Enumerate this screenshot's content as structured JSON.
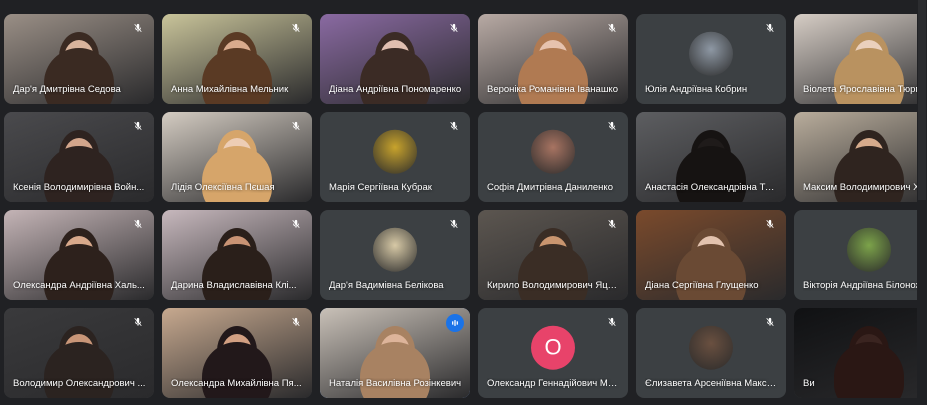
{
  "participants": [
    {
      "name": "Дар'я Дмитрівна Седова",
      "type": "video",
      "bg": "#9a8f86",
      "skin": "#d9b49c",
      "hair": "#3a2a22",
      "muted": true
    },
    {
      "name": "Анна Михайлівна Мельник",
      "type": "video",
      "bg": "#c9c49a",
      "skin": "#d9ab8d",
      "hair": "#5a3a24",
      "muted": true
    },
    {
      "name": "Діана Андріївна Пономаренко",
      "type": "video",
      "bg": "#8a6aa2",
      "skin": "#e1bfb0",
      "hair": "#3b2b25",
      "muted": true
    },
    {
      "name": "Вероніка Романівна Іванашко",
      "type": "video",
      "bg": "#b8aaa4",
      "skin": "#e6c2ae",
      "hair": "#b07a52",
      "muted": true
    },
    {
      "name": "Юлія Андріївна Кобрин",
      "type": "avatar",
      "avatar_color": "#8e98a4",
      "muted": true
    },
    {
      "name": "Віолета Ярославівна Тюрме...",
      "type": "video",
      "bg": "#d6cdc5",
      "skin": "#ead0bd",
      "hair": "#b99260",
      "muted": false
    },
    {
      "name": "Ксенія Володимирівна Войн...",
      "type": "video",
      "bg": "#4a4a4d",
      "skin": "#d3a68c",
      "hair": "#2e2320",
      "muted": true
    },
    {
      "name": "Лідія Олексіївна Пєшая",
      "type": "video",
      "bg": "#d4ccc2",
      "skin": "#edcdb5",
      "hair": "#d6a56a",
      "muted": true
    },
    {
      "name": "Марія Сергіївна Кубрак",
      "type": "avatar",
      "avatar_color": "#c8a32c",
      "muted": true
    },
    {
      "name": "Софія Дмитрівна Даниленко",
      "type": "avatar",
      "avatar_color": "#a87462",
      "muted": true
    },
    {
      "name": "Анастасія Олександрівна Те...",
      "type": "video",
      "bg": "#5d5e61",
      "skin": "#1f1b1a",
      "hair": "#161312",
      "muted": false
    },
    {
      "name": "Максим Володимирович Хо...",
      "type": "video",
      "bg": "#b9ad9c",
      "skin": "#d6ab8c",
      "hair": "#2f241f",
      "muted": false
    },
    {
      "name": "Олександра Андріївна Халь...",
      "type": "video",
      "bg": "#c4b4b6",
      "skin": "#d8a98b",
      "hair": "#2d211c",
      "muted": true
    },
    {
      "name": "Дарина Владиславівна Клі...",
      "type": "video",
      "bg": "#c7b8bd",
      "skin": "#c99374",
      "hair": "#2a1f1a",
      "muted": true
    },
    {
      "name": "Дар'я Вадимівна Белікова",
      "type": "avatar",
      "avatar_color": "#d7c9a6",
      "muted": true
    },
    {
      "name": "Кирило Володимирович Яце...",
      "type": "video",
      "bg": "#5c5650",
      "skin": "#c9956f",
      "hair": "#3a2d25",
      "muted": true
    },
    {
      "name": "Діана Сергіївна Глущенко",
      "type": "video",
      "bg": "#7a4a2c",
      "skin": "#e2c2ae",
      "hair": "#6a4a34",
      "muted": true
    },
    {
      "name": "Вікторія Андріївна Білоножко",
      "type": "avatar",
      "avatar_color": "#7ca34a",
      "muted": true
    },
    {
      "name": "Володимир Олександрович ...",
      "type": "video",
      "bg": "#3a3a3c",
      "skin": "#c99678",
      "hair": "#2b2320",
      "muted": true
    },
    {
      "name": "Олександра Михайлівна Пя...",
      "type": "video",
      "bg": "#c7a98f",
      "skin": "#d29f82",
      "hair": "#22181a",
      "muted": true
    },
    {
      "name": "Наталія Василівна Розінкевич",
      "type": "video",
      "bg": "#c9c1b8",
      "skin": "#ddb49a",
      "hair": "#a88262",
      "muted": false,
      "speaking": true
    },
    {
      "name": "Олександр Геннадійович Мух...",
      "type": "letter",
      "letter": "O",
      "avatar_color": "#e8436a",
      "muted": true
    },
    {
      "name": "Єлизавета Арсеніївна Макси...",
      "type": "avatar",
      "avatar_color": "#6a5040",
      "muted": true
    },
    {
      "name": "Ви",
      "type": "video",
      "bg": "#101113",
      "skin": "#3a2420",
      "hair": "#2a1714",
      "muted": false
    }
  ],
  "icons": {
    "mic_off": "mic-off-icon",
    "speaking": "audio-level-icon"
  }
}
